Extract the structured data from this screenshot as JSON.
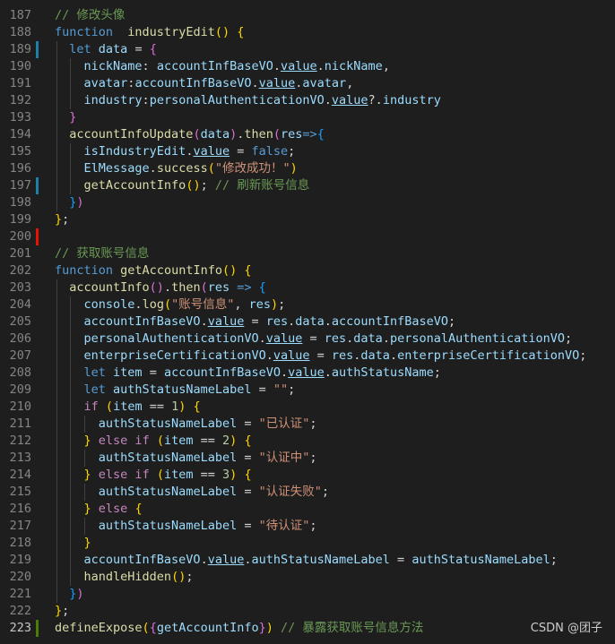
{
  "editor": {
    "lines": [
      {
        "n": "187",
        "t": [
          [
            "cm",
            "// 修改头像"
          ]
        ]
      },
      {
        "n": "188",
        "t": [
          [
            "kw",
            "function"
          ],
          [
            "",
            "  "
          ],
          [
            "fn",
            "industryEdit"
          ],
          [
            "p1",
            "()"
          ],
          [
            "",
            " "
          ],
          [
            "p1",
            "{"
          ]
        ]
      },
      {
        "n": "189",
        "t": [
          [
            "",
            "  "
          ],
          [
            "kw",
            "let"
          ],
          [
            "",
            " "
          ],
          [
            "var",
            "data"
          ],
          [
            "",
            " = "
          ],
          [
            "p2",
            "{"
          ]
        ]
      },
      {
        "n": "190",
        "t": [
          [
            "",
            "    "
          ],
          [
            "var",
            "nickName"
          ],
          [
            "",
            ": "
          ],
          [
            "var",
            "accountInfBaseVO"
          ],
          [
            "",
            "."
          ],
          [
            "var u",
            "value"
          ],
          [
            "",
            "."
          ],
          [
            "var",
            "nickName"
          ],
          [
            "",
            ","
          ]
        ]
      },
      {
        "n": "191",
        "t": [
          [
            "",
            "    "
          ],
          [
            "var",
            "avatar"
          ],
          [
            "",
            ":"
          ],
          [
            "var",
            "accountInfBaseVO"
          ],
          [
            "",
            "."
          ],
          [
            "var u",
            "value"
          ],
          [
            "",
            "."
          ],
          [
            "var",
            "avatar"
          ],
          [
            "",
            ","
          ]
        ]
      },
      {
        "n": "192",
        "t": [
          [
            "",
            "    "
          ],
          [
            "var",
            "industry"
          ],
          [
            "",
            ":"
          ],
          [
            "var",
            "personalAuthenticationVO"
          ],
          [
            "",
            "."
          ],
          [
            "var u",
            "value"
          ],
          [
            "",
            "?."
          ],
          [
            "var",
            "industry"
          ]
        ]
      },
      {
        "n": "193",
        "t": [
          [
            "",
            "  "
          ],
          [
            "p2",
            "}"
          ]
        ]
      },
      {
        "n": "194",
        "t": [
          [
            "",
            "  "
          ],
          [
            "fn",
            "accountInfoUpdate"
          ],
          [
            "p2",
            "("
          ],
          [
            "var",
            "data"
          ],
          [
            "p2",
            ")"
          ],
          [
            "",
            "."
          ],
          [
            "fn",
            "then"
          ],
          [
            "p2",
            "("
          ],
          [
            "var",
            "res"
          ],
          [
            "kw",
            "=>"
          ],
          [
            "p3",
            "{"
          ]
        ]
      },
      {
        "n": "195",
        "t": [
          [
            "",
            "    "
          ],
          [
            "var",
            "isIndustryEdit"
          ],
          [
            "",
            "."
          ],
          [
            "var u",
            "value"
          ],
          [
            "",
            " = "
          ],
          [
            "kw",
            "false"
          ],
          [
            "",
            ";"
          ]
        ]
      },
      {
        "n": "196",
        "t": [
          [
            "",
            "    "
          ],
          [
            "var",
            "ElMessage"
          ],
          [
            "",
            "."
          ],
          [
            "fn",
            "success"
          ],
          [
            "p1",
            "("
          ],
          [
            "str",
            "\"修改成功！\""
          ],
          [
            "p1",
            ")"
          ]
        ]
      },
      {
        "n": "197",
        "t": [
          [
            "",
            "    "
          ],
          [
            "fn",
            "getAccountInfo"
          ],
          [
            "p1",
            "()"
          ],
          [
            "",
            "; "
          ],
          [
            "cm",
            "// 刷新账号信息"
          ]
        ]
      },
      {
        "n": "198",
        "t": [
          [
            "",
            "  "
          ],
          [
            "p3",
            "}"
          ],
          [
            "p2",
            ")"
          ]
        ]
      },
      {
        "n": "199",
        "t": [
          [
            "p1",
            "}"
          ],
          [
            "",
            ";"
          ]
        ]
      },
      {
        "n": "200",
        "t": []
      },
      {
        "n": "201",
        "t": [
          [
            "cm",
            "// 获取账号信息"
          ]
        ]
      },
      {
        "n": "202",
        "t": [
          [
            "kw",
            "function"
          ],
          [
            "",
            " "
          ],
          [
            "fn",
            "getAccountInfo"
          ],
          [
            "p1",
            "()"
          ],
          [
            "",
            " "
          ],
          [
            "p1",
            "{"
          ]
        ]
      },
      {
        "n": "203",
        "t": [
          [
            "",
            "  "
          ],
          [
            "fn",
            "accountInfo"
          ],
          [
            "p2",
            "()"
          ],
          [
            "",
            "."
          ],
          [
            "fn",
            "then"
          ],
          [
            "p2",
            "("
          ],
          [
            "var",
            "res"
          ],
          [
            "",
            " "
          ],
          [
            "kw",
            "=>"
          ],
          [
            "",
            " "
          ],
          [
            "p3",
            "{"
          ]
        ]
      },
      {
        "n": "204",
        "t": [
          [
            "",
            "    "
          ],
          [
            "var",
            "console"
          ],
          [
            "",
            "."
          ],
          [
            "fn",
            "log"
          ],
          [
            "p1",
            "("
          ],
          [
            "str",
            "\"账号信息\""
          ],
          [
            "",
            ", "
          ],
          [
            "var",
            "res"
          ],
          [
            "p1",
            ")"
          ],
          [
            "",
            ";"
          ]
        ]
      },
      {
        "n": "205",
        "t": [
          [
            "",
            "    "
          ],
          [
            "var",
            "accountInfBaseVO"
          ],
          [
            "",
            "."
          ],
          [
            "var u",
            "value"
          ],
          [
            "",
            " = "
          ],
          [
            "var",
            "res"
          ],
          [
            "",
            "."
          ],
          [
            "var",
            "data"
          ],
          [
            "",
            "."
          ],
          [
            "var",
            "accountInfBaseVO"
          ],
          [
            "",
            ";"
          ]
        ]
      },
      {
        "n": "206",
        "t": [
          [
            "",
            "    "
          ],
          [
            "var",
            "personalAuthenticationVO"
          ],
          [
            "",
            "."
          ],
          [
            "var u",
            "value"
          ],
          [
            "",
            " = "
          ],
          [
            "var",
            "res"
          ],
          [
            "",
            "."
          ],
          [
            "var",
            "data"
          ],
          [
            "",
            "."
          ],
          [
            "var",
            "personalAuthenticationVO"
          ],
          [
            "",
            ";"
          ]
        ]
      },
      {
        "n": "207",
        "t": [
          [
            "",
            "    "
          ],
          [
            "var",
            "enterpriseCertificationVO"
          ],
          [
            "",
            "."
          ],
          [
            "var u",
            "value"
          ],
          [
            "",
            " = "
          ],
          [
            "var",
            "res"
          ],
          [
            "",
            "."
          ],
          [
            "var",
            "data"
          ],
          [
            "",
            "."
          ],
          [
            "var",
            "enterpriseCertificationVO"
          ],
          [
            "",
            ";"
          ]
        ]
      },
      {
        "n": "208",
        "t": [
          [
            "",
            "    "
          ],
          [
            "kw",
            "let"
          ],
          [
            "",
            " "
          ],
          [
            "var",
            "item"
          ],
          [
            "",
            " = "
          ],
          [
            "var",
            "accountInfBaseVO"
          ],
          [
            "",
            "."
          ],
          [
            "var u",
            "value"
          ],
          [
            "",
            "."
          ],
          [
            "var",
            "authStatusName"
          ],
          [
            "",
            ";"
          ]
        ]
      },
      {
        "n": "209",
        "t": [
          [
            "",
            "    "
          ],
          [
            "kw",
            "let"
          ],
          [
            "",
            " "
          ],
          [
            "var",
            "authStatusNameLabel"
          ],
          [
            "",
            " = "
          ],
          [
            "str",
            "\"\""
          ],
          [
            "",
            ";"
          ]
        ]
      },
      {
        "n": "210",
        "t": [
          [
            "",
            "    "
          ],
          [
            "ctl",
            "if"
          ],
          [
            "",
            " "
          ],
          [
            "p1",
            "("
          ],
          [
            "var",
            "item"
          ],
          [
            "",
            " == "
          ],
          [
            "num",
            "1"
          ],
          [
            "p1",
            ")"
          ],
          [
            "",
            " "
          ],
          [
            "p1",
            "{"
          ]
        ]
      },
      {
        "n": "211",
        "t": [
          [
            "",
            "      "
          ],
          [
            "var",
            "authStatusNameLabel"
          ],
          [
            "",
            " = "
          ],
          [
            "str",
            "\"已认证\""
          ],
          [
            "",
            ";"
          ]
        ]
      },
      {
        "n": "212",
        "t": [
          [
            "",
            "    "
          ],
          [
            "p1",
            "}"
          ],
          [
            "",
            " "
          ],
          [
            "ctl",
            "else if"
          ],
          [
            "",
            " "
          ],
          [
            "p1",
            "("
          ],
          [
            "var",
            "item"
          ],
          [
            "",
            " == "
          ],
          [
            "num",
            "2"
          ],
          [
            "p1",
            ")"
          ],
          [
            "",
            " "
          ],
          [
            "p1",
            "{"
          ]
        ]
      },
      {
        "n": "213",
        "t": [
          [
            "",
            "      "
          ],
          [
            "var",
            "authStatusNameLabel"
          ],
          [
            "",
            " = "
          ],
          [
            "str",
            "\"认证中\""
          ],
          [
            "",
            ";"
          ]
        ]
      },
      {
        "n": "214",
        "t": [
          [
            "",
            "    "
          ],
          [
            "p1",
            "}"
          ],
          [
            "",
            " "
          ],
          [
            "ctl",
            "else if"
          ],
          [
            "",
            " "
          ],
          [
            "p1",
            "("
          ],
          [
            "var",
            "item"
          ],
          [
            "",
            " == "
          ],
          [
            "num",
            "3"
          ],
          [
            "p1",
            ")"
          ],
          [
            "",
            " "
          ],
          [
            "p1",
            "{"
          ]
        ]
      },
      {
        "n": "215",
        "t": [
          [
            "",
            "      "
          ],
          [
            "var",
            "authStatusNameLabel"
          ],
          [
            "",
            " = "
          ],
          [
            "str",
            "\"认证失败\""
          ],
          [
            "",
            ";"
          ]
        ]
      },
      {
        "n": "216",
        "t": [
          [
            "",
            "    "
          ],
          [
            "p1",
            "}"
          ],
          [
            "",
            " "
          ],
          [
            "ctl",
            "else"
          ],
          [
            "",
            " "
          ],
          [
            "p1",
            "{"
          ]
        ]
      },
      {
        "n": "217",
        "t": [
          [
            "",
            "      "
          ],
          [
            "var",
            "authStatusNameLabel"
          ],
          [
            "",
            " = "
          ],
          [
            "str",
            "\"待认证\""
          ],
          [
            "",
            ";"
          ]
        ]
      },
      {
        "n": "218",
        "t": [
          [
            "",
            "    "
          ],
          [
            "p1",
            "}"
          ]
        ]
      },
      {
        "n": "219",
        "t": [
          [
            "",
            "    "
          ],
          [
            "var",
            "accountInfBaseVO"
          ],
          [
            "",
            "."
          ],
          [
            "var u",
            "value"
          ],
          [
            "",
            "."
          ],
          [
            "var",
            "authStatusNameLabel"
          ],
          [
            "",
            " = "
          ],
          [
            "var",
            "authStatusNameLabel"
          ],
          [
            "",
            ";"
          ]
        ]
      },
      {
        "n": "220",
        "t": [
          [
            "",
            "    "
          ],
          [
            "fn",
            "handleHidden"
          ],
          [
            "p1",
            "()"
          ],
          [
            "",
            ";"
          ]
        ]
      },
      {
        "n": "221",
        "t": [
          [
            "",
            "  "
          ],
          [
            "p3",
            "}"
          ],
          [
            "p2",
            ")"
          ]
        ]
      },
      {
        "n": "222",
        "t": [
          [
            "p1",
            "}"
          ],
          [
            "",
            ";"
          ]
        ]
      },
      {
        "n": "223",
        "t": [
          [
            "fn",
            "defineExpose"
          ],
          [
            "p1",
            "("
          ],
          [
            "p2",
            "{"
          ],
          [
            "var",
            "getAccountInfo"
          ],
          [
            "p2",
            "}"
          ],
          [
            "p1",
            ")"
          ],
          [
            "",
            " "
          ],
          [
            "cm",
            "// 暴露获取账号信息方法"
          ]
        ]
      }
    ],
    "active_line": "223",
    "gutter_marks": [
      {
        "line": "189",
        "color": "#1b81a8"
      },
      {
        "line": "197",
        "color": "#1b81a8"
      },
      {
        "line": "200",
        "color": "#e51400"
      },
      {
        "line": "223",
        "color": "#487e02"
      }
    ]
  },
  "watermark": "CSDN @团子"
}
